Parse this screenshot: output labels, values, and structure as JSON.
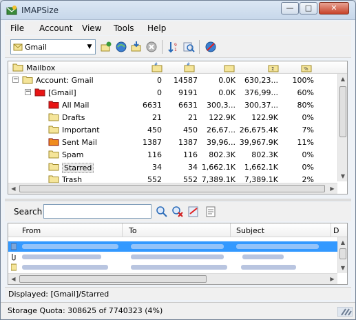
{
  "window": {
    "title": "IMAPSize"
  },
  "controls": {
    "minimize": "—",
    "maximize": "□",
    "close": "✕"
  },
  "menu": [
    "File",
    "Account",
    "View",
    "Tools",
    "Help"
  ],
  "toolbar": {
    "account_value": "Gmail",
    "buttons": [
      "connect-icon",
      "refresh-icon",
      "download-icon",
      "stop-icon",
      "sort-icon",
      "search-icon",
      "wizard-icon"
    ]
  },
  "tree": {
    "header": {
      "mailbox": "Mailbox"
    },
    "rows": [
      {
        "name": "Account: Gmail",
        "c1": "0",
        "c2": "14587",
        "c3": "0.0K",
        "c4": "630,23...",
        "c5": "100%",
        "indent": 0,
        "color": "#f5e59a",
        "expander": "−"
      },
      {
        "name": "[Gmail]",
        "c1": "0",
        "c2": "9191",
        "c3": "0.0K",
        "c4": "376,99...",
        "c5": "60%",
        "indent": 1,
        "color": "#e81414",
        "expander": "−"
      },
      {
        "name": "All Mail",
        "c1": "6631",
        "c2": "6631",
        "c3": "300,3...",
        "c4": "300,37...",
        "c5": "80%",
        "indent": 2,
        "color": "#e81414",
        "expander": ""
      },
      {
        "name": "Drafts",
        "c1": "21",
        "c2": "21",
        "c3": "122.9K",
        "c4": "122.9K",
        "c5": "0%",
        "indent": 2,
        "color": "#f5e59a",
        "expander": ""
      },
      {
        "name": "Important",
        "c1": "450",
        "c2": "450",
        "c3": "26,67...",
        "c4": "26,675.4K",
        "c5": "7%",
        "indent": 2,
        "color": "#f5e59a",
        "expander": ""
      },
      {
        "name": "Sent Mail",
        "c1": "1387",
        "c2": "1387",
        "c3": "39,96...",
        "c4": "39,967.9K",
        "c5": "11%",
        "indent": 2,
        "color": "#f08c1e",
        "expander": ""
      },
      {
        "name": "Spam",
        "c1": "116",
        "c2": "116",
        "c3": "802.3K",
        "c4": "802.3K",
        "c5": "0%",
        "indent": 2,
        "color": "#f5e59a",
        "expander": ""
      },
      {
        "name": "Starred",
        "c1": "34",
        "c2": "34",
        "c3": "1,662.1K",
        "c4": "1,662.1K",
        "c5": "0%",
        "indent": 2,
        "color": "#f5e59a",
        "expander": "",
        "selected": true
      },
      {
        "name": "Trash",
        "c1": "552",
        "c2": "552",
        "c3": "7,389.1K",
        "c4": "7,389.1K",
        "c5": "2%",
        "indent": 2,
        "color": "#f5e59a",
        "expander": ""
      }
    ]
  },
  "search": {
    "label": "Search",
    "value": "",
    "buttons": [
      "search-go-icon",
      "search-clear-icon",
      "search-options-icon",
      "search-results-icon"
    ]
  },
  "messages": {
    "columns": [
      "From",
      "To",
      "Subject",
      "D"
    ]
  },
  "status": {
    "displayed": "Displayed: [Gmail]/Starred",
    "quota": "Storage Quota: 308625 of 7740323 (4%)"
  },
  "colors": {
    "accent": "#3399ff",
    "folder": "#f5e59a",
    "gmail": "#e81414",
    "sent": "#f08c1e"
  }
}
